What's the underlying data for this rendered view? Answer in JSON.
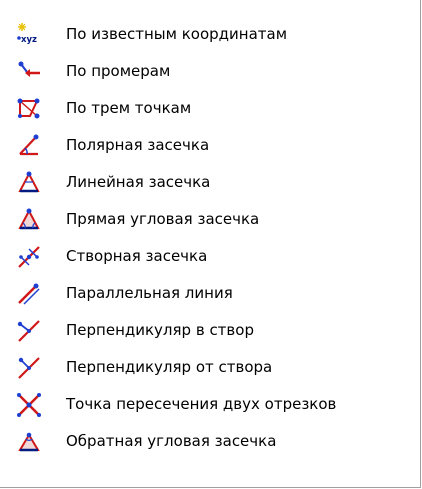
{
  "menu": {
    "items": [
      {
        "label": "По известным координатам",
        "icon": "xyz-coordinates-icon"
      },
      {
        "label": "По промерам",
        "icon": "measurements-icon"
      },
      {
        "label": "По трем точкам",
        "icon": "three-points-icon"
      },
      {
        "label": "Полярная засечка",
        "icon": "polar-intersection-icon"
      },
      {
        "label": "Линейная засечка",
        "icon": "linear-intersection-icon"
      },
      {
        "label": "Прямая угловая засечка",
        "icon": "direct-angular-intersection-icon"
      },
      {
        "label": "Створная засечка",
        "icon": "alignment-intersection-icon"
      },
      {
        "label": "Параллельная линия",
        "icon": "parallel-line-icon"
      },
      {
        "label": "Перпендикуляр в створ",
        "icon": "perpendicular-to-alignment-icon"
      },
      {
        "label": "Перпендикуляр от створа",
        "icon": "perpendicular-from-alignment-icon"
      },
      {
        "label": "Точка пересечения двух отрезков",
        "icon": "segments-intersection-icon"
      },
      {
        "label": "Обратная угловая засечка",
        "icon": "reverse-angular-intersection-icon"
      }
    ],
    "colors": {
      "blue": "#1f3fd0",
      "red": "#d01818",
      "navy": "#001a80",
      "yellow": "#e8c000"
    }
  }
}
